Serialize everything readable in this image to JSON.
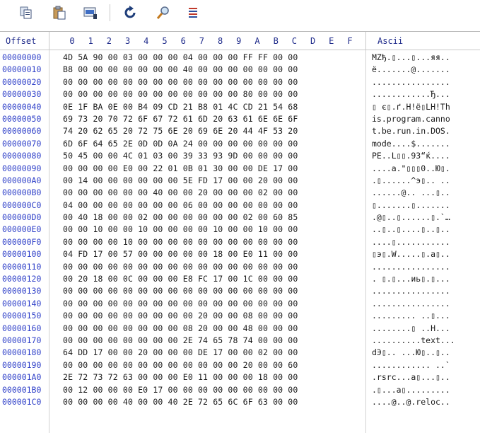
{
  "toolbar": {
    "buttons": [
      {
        "name": "copy-button",
        "icon": "copy-icon"
      },
      {
        "name": "paste-button",
        "icon": "paste-icon"
      },
      {
        "name": "select-all-button",
        "icon": "select-icon"
      },
      {
        "name": "goto-button",
        "icon": "goto-arrow-icon"
      },
      {
        "name": "search-button",
        "icon": "magnifier-icon"
      },
      {
        "name": "options-button",
        "icon": "list-settings-icon"
      }
    ]
  },
  "header": {
    "offset_label": "Offset",
    "ascii_label": "Ascii",
    "columns": [
      "0",
      "1",
      "2",
      "3",
      "4",
      "5",
      "6",
      "7",
      "8",
      "9",
      "A",
      "B",
      "C",
      "D",
      "E",
      "F"
    ]
  },
  "rows": [
    {
      "offset": "00000000",
      "hex": "4D 5A 90 00 03 00 00 00 04 00 00 00 FF FF 00 00",
      "ascii": "MZђ.▯...▯...яя.."
    },
    {
      "offset": "00000010",
      "hex": "B8 00 00 00 00 00 00 00 40 00 00 00 00 00 00 00",
      "ascii": "ё.......@......."
    },
    {
      "offset": "00000020",
      "hex": "00 00 00 00 00 00 00 00 00 00 00 00 00 00 00 00",
      "ascii": "................"
    },
    {
      "offset": "00000030",
      "hex": "00 00 00 00 00 00 00 00 00 00 00 00 80 00 00 00",
      "ascii": "............Ђ..."
    },
    {
      "offset": "00000040",
      "hex": "0E 1F BA 0E 00 B4 09 CD 21 B8 01 4C CD 21 54 68",
      "ascii": "▯ є▯.ґ.Н!ё▯LН!Th"
    },
    {
      "offset": "00000050",
      "hex": "69 73 20 70 72 6F 67 72 61 6D 20 63 61 6E 6E 6F",
      "ascii": "is.program.canno"
    },
    {
      "offset": "00000060",
      "hex": "74 20 62 65 20 72 75 6E 20 69 6E 20 44 4F 53 20",
      "ascii": "t.be.run.in.DOS."
    },
    {
      "offset": "00000070",
      "hex": "6D 6F 64 65 2E 0D 0D 0A 24 00 00 00 00 00 00 00",
      "ascii": "mode....$......."
    },
    {
      "offset": "00000080",
      "hex": "50 45 00 00 4C 01 03 00 39 33 93 9D 00 00 00 00",
      "ascii": "PE..L▯▯.93“ќ...."
    },
    {
      "offset": "00000090",
      "hex": "00 00 00 00 E0 00 22 01 0B 01 30 00 00 DE 17 00",
      "ascii": "....а.\"▯▯▯0..Ю▯."
    },
    {
      "offset": "000000A0",
      "hex": "00 14 00 00 00 00 00 00 5E FD 17 00 00 20 00 00",
      "ascii": ".▯......^э▯.. .."
    },
    {
      "offset": "000000B0",
      "hex": "00 00 00 00 00 00 40 00 00 20 00 00 00 02 00 00",
      "ascii": "......@.. ...▯.."
    },
    {
      "offset": "000000C0",
      "hex": "04 00 00 00 00 00 00 00 06 00 00 00 00 00 00 00",
      "ascii": "▯.......▯......."
    },
    {
      "offset": "000000D0",
      "hex": "00 40 18 00 00 02 00 00 00 00 00 00 02 00 60 85",
      "ascii": ".@▯..▯......▯.`…"
    },
    {
      "offset": "000000E0",
      "hex": "00 00 10 00 00 10 00 00 00 00 10 00 00 10 00 00",
      "ascii": "..▯..▯....▯..▯.."
    },
    {
      "offset": "000000F0",
      "hex": "00 00 00 00 10 00 00 00 00 00 00 00 00 00 00 00",
      "ascii": "....▯..........."
    },
    {
      "offset": "00000100",
      "hex": "04 FD 17 00 57 00 00 00 00 00 18 00 E0 11 00 00",
      "ascii": "▯э▯.W.....▯.а▯.."
    },
    {
      "offset": "00000110",
      "hex": "00 00 00 00 00 00 00 00 00 00 00 00 00 00 00 00",
      "ascii": "................"
    },
    {
      "offset": "00000120",
      "hex": "00 20 18 00 0C 00 00 00 E8 FC 17 00 1C 00 00 00",
      "ascii": ". ▯.▯...иь▯.▯..."
    },
    {
      "offset": "00000130",
      "hex": "00 00 00 00 00 00 00 00 00 00 00 00 00 00 00 00",
      "ascii": "................"
    },
    {
      "offset": "00000140",
      "hex": "00 00 00 00 00 00 00 00 00 00 00 00 00 00 00 00",
      "ascii": "................"
    },
    {
      "offset": "00000150",
      "hex": "00 00 00 00 00 00 00 00 00 20 00 00 08 00 00 00",
      "ascii": "......... ..▯..."
    },
    {
      "offset": "00000160",
      "hex": "00 00 00 00 00 00 00 00 08 20 00 00 48 00 00 00",
      "ascii": "........▯ ..H..."
    },
    {
      "offset": "00000170",
      "hex": "00 00 00 00 00 00 00 00 2E 74 65 78 74 00 00 00",
      "ascii": "..........text..."
    },
    {
      "offset": "00000180",
      "hex": "64 DD 17 00 00 20 00 00 00 DE 17 00 00 02 00 00",
      "ascii": "dЭ▯.. ...Ю▯..▯.."
    },
    {
      "offset": "00000190",
      "hex": "00 00 00 00 00 00 00 00 00 00 00 00 20 00 00 60",
      "ascii": "............ ..`"
    },
    {
      "offset": "000001A0",
      "hex": "2E 72 73 72 63 00 00 00 E0 11 00 00 00 18 00 00",
      "ascii": ".rsrc...а▯...▯.."
    },
    {
      "offset": "000001B0",
      "hex": "00 12 00 00 00 E0 17 00 00 00 00 00 00 00 00 00",
      "ascii": ".▯...а▯........."
    },
    {
      "offset": "000001C0",
      "hex": "00 00 00 00 40 00 00 40 2E 72 65 6C 6F 63 00 00",
      "ascii": "....@..@.reloc.."
    }
  ]
}
